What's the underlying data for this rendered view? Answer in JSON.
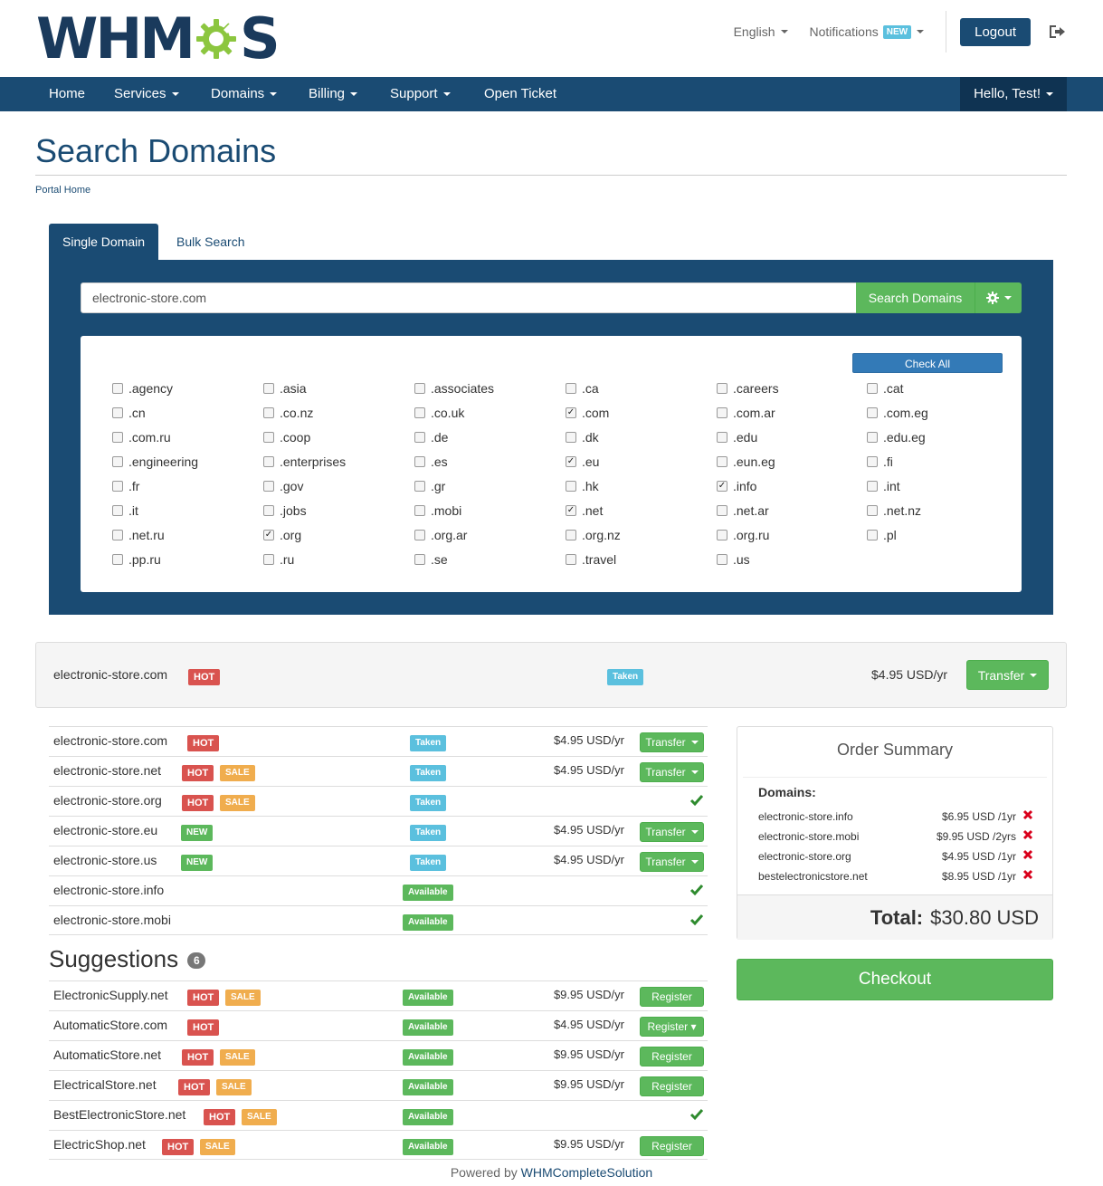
{
  "header": {
    "logo_text_left": "WHM",
    "logo_text_right": "S",
    "language": "English",
    "notifications": "Notifications",
    "notifications_badge": "NEW",
    "logout": "Logout"
  },
  "nav": {
    "items": [
      {
        "label": "Home"
      },
      {
        "label": "Services"
      },
      {
        "label": "Domains"
      },
      {
        "label": "Billing"
      },
      {
        "label": "Support"
      },
      {
        "label": "Open Ticket"
      }
    ],
    "user": "Hello, Test!"
  },
  "page": {
    "title": "Search Domains",
    "breadcrumb": "Portal Home"
  },
  "search": {
    "tabs": [
      "Single Domain",
      "Bulk Search"
    ],
    "query": "electronic-store.com",
    "button": "Search Domains",
    "check_all": "Check All",
    "tlds": [
      {
        "name": ".agency",
        "checked": false
      },
      {
        "name": ".asia",
        "checked": false
      },
      {
        "name": ".associates",
        "checked": false
      },
      {
        "name": ".ca",
        "checked": false
      },
      {
        "name": ".careers",
        "checked": false
      },
      {
        "name": ".cat",
        "checked": false
      },
      {
        "name": ".cn",
        "checked": false
      },
      {
        "name": ".co.nz",
        "checked": false
      },
      {
        "name": ".co.uk",
        "checked": false
      },
      {
        "name": ".com",
        "checked": true
      },
      {
        "name": ".com.ar",
        "checked": false
      },
      {
        "name": ".com.eg",
        "checked": false
      },
      {
        "name": ".com.ru",
        "checked": false
      },
      {
        "name": ".coop",
        "checked": false
      },
      {
        "name": ".de",
        "checked": false
      },
      {
        "name": ".dk",
        "checked": false
      },
      {
        "name": ".edu",
        "checked": false
      },
      {
        "name": ".edu.eg",
        "checked": false
      },
      {
        "name": ".engineering",
        "checked": false
      },
      {
        "name": ".enterprises",
        "checked": false
      },
      {
        "name": ".es",
        "checked": false
      },
      {
        "name": ".eu",
        "checked": true
      },
      {
        "name": ".eun.eg",
        "checked": false
      },
      {
        "name": ".fi",
        "checked": false
      },
      {
        "name": ".fr",
        "checked": false
      },
      {
        "name": ".gov",
        "checked": false
      },
      {
        "name": ".gr",
        "checked": false
      },
      {
        "name": ".hk",
        "checked": false
      },
      {
        "name": ".info",
        "checked": true
      },
      {
        "name": ".int",
        "checked": false
      },
      {
        "name": ".it",
        "checked": false
      },
      {
        "name": ".jobs",
        "checked": false
      },
      {
        "name": ".mobi",
        "checked": false
      },
      {
        "name": ".net",
        "checked": true
      },
      {
        "name": ".net.ar",
        "checked": false
      },
      {
        "name": ".net.nz",
        "checked": false
      },
      {
        "name": ".net.ru",
        "checked": false
      },
      {
        "name": ".org",
        "checked": true
      },
      {
        "name": ".org.ar",
        "checked": false
      },
      {
        "name": ".org.nz",
        "checked": false
      },
      {
        "name": ".org.ru",
        "checked": false
      },
      {
        "name": ".pl",
        "checked": false
      },
      {
        "name": ".pp.ru",
        "checked": false
      },
      {
        "name": ".ru",
        "checked": false
      },
      {
        "name": ".se",
        "checked": false
      },
      {
        "name": ".travel",
        "checked": false
      },
      {
        "name": ".us",
        "checked": false
      }
    ]
  },
  "main_result": {
    "domain": "electronic-store.com",
    "badge": "HOT",
    "status": "Taken",
    "price": "$4.95 USD/yr",
    "action": "Transfer"
  },
  "results": [
    {
      "domain": "electronic-store.com",
      "badges": [
        "HOT"
      ],
      "status": "Taken",
      "price": "$4.95 USD/yr",
      "action": "Transfer"
    },
    {
      "domain": "electronic-store.net",
      "badges": [
        "HOT",
        "SALE"
      ],
      "status": "Taken",
      "price": "$4.95 USD/yr",
      "action": "Transfer"
    },
    {
      "domain": "electronic-store.org",
      "badges": [
        "HOT",
        "SALE"
      ],
      "status": "Taken",
      "price": "",
      "action": ""
    },
    {
      "domain": "electronic-store.eu",
      "badges": [
        "NEW"
      ],
      "status": "Taken",
      "price": "$4.95 USD/yr",
      "action": "Transfer"
    },
    {
      "domain": "electronic-store.us",
      "badges": [
        "NEW"
      ],
      "status": "Taken",
      "price": "$4.95 USD/yr",
      "action": "Transfer"
    },
    {
      "domain": "electronic-store.info",
      "badges": [],
      "status": "Available",
      "price": "",
      "action": ""
    },
    {
      "domain": "electronic-store.mobi",
      "badges": [],
      "status": "Available",
      "price": "",
      "action": ""
    }
  ],
  "suggestions": {
    "title": "Suggestions",
    "count": "6",
    "items": [
      {
        "domain": "ElectronicSupply.net",
        "badges": [
          "HOT",
          "SALE"
        ],
        "status": "Available",
        "price": "$9.95 USD/yr",
        "action": "Register"
      },
      {
        "domain": "AutomaticStore.com",
        "badges": [
          "HOT"
        ],
        "status": "Available",
        "price": "$4.95 USD/yr",
        "action": "Register ▾"
      },
      {
        "domain": "AutomaticStore.net",
        "badges": [
          "HOT",
          "SALE"
        ],
        "status": "Available",
        "price": "$9.95 USD/yr",
        "action": "Register"
      },
      {
        "domain": "ElectricalStore.net",
        "badges": [
          "HOT",
          "SALE"
        ],
        "status": "Available",
        "price": "$9.95 USD/yr",
        "action": "Register"
      },
      {
        "domain": "BestElectronicStore.net",
        "badges": [
          "HOT",
          "SALE"
        ],
        "status": "Available",
        "price": "",
        "action": ""
      },
      {
        "domain": "ElectricShop.net",
        "badges": [
          "HOT",
          "SALE"
        ],
        "status": "Available",
        "price": "$9.95 USD/yr",
        "action": "Register"
      }
    ]
  },
  "summary": {
    "title": "Order Summary",
    "domains_label": "Domains:",
    "lines": [
      {
        "name": "electronic-store.info",
        "price": "$6.95 USD /1yr"
      },
      {
        "name": "electronic-store.mobi",
        "price": "$9.95 USD /2yrs"
      },
      {
        "name": "electronic-store.org",
        "price": "$4.95 USD /1yr"
      },
      {
        "name": "bestelectronicstore.net",
        "price": "$8.95 USD /1yr"
      }
    ],
    "total_label": "Total:",
    "total_value": "$30.80 USD",
    "checkout": "Checkout"
  },
  "footer": {
    "prefix": "Powered by",
    "link": "WHMCompleteSolution"
  },
  "colors": {
    "primary": "#1a4b73",
    "success": "#5cb85c",
    "danger": "#d9534f",
    "warning": "#f0ad4e",
    "info": "#5bc0de"
  }
}
